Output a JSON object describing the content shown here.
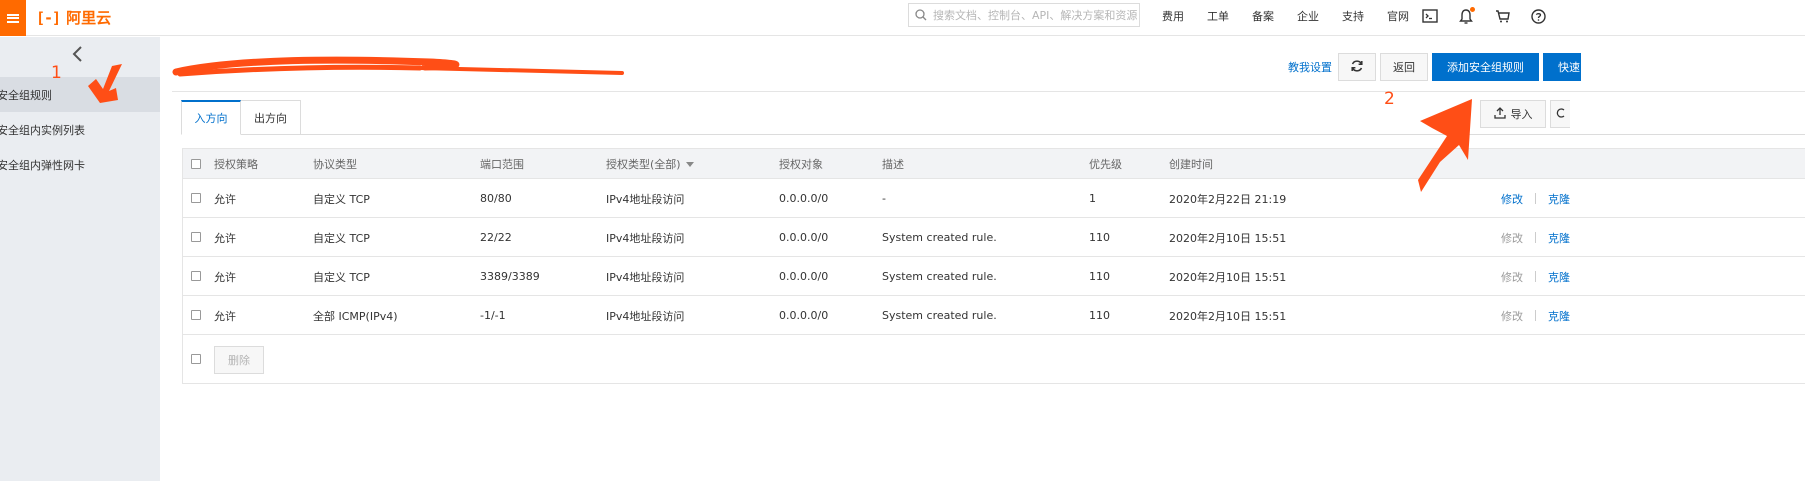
{
  "topbar": {
    "logo_mark": "[-]",
    "brand": "阿里云",
    "search_placeholder": "搜索文档、控制台、API、解决方案和资源",
    "links": [
      "费用",
      "工单",
      "备案",
      "企业",
      "支持",
      "官网"
    ],
    "icons": [
      "terminal-icon",
      "bell-icon",
      "cart-icon",
      "help-icon"
    ],
    "accent": "#ff6a00"
  },
  "sidebar": {
    "items": [
      {
        "label": "安全组规则",
        "active": true
      },
      {
        "label": "安全组内实例列表",
        "active": false
      },
      {
        "label": "安全组内弹性网卡",
        "active": false
      }
    ]
  },
  "header": {
    "help_link": "教我设置",
    "back_label": "返回",
    "add_rule_label": "添加安全组规则",
    "quick_label": "快速"
  },
  "tabs": [
    {
      "label": "入方向",
      "active": true
    },
    {
      "label": "出方向",
      "active": false
    }
  ],
  "toolbar": {
    "import_label": "导入"
  },
  "table": {
    "headers": {
      "policy": "授权策略",
      "protocol": "协议类型",
      "port": "端口范围",
      "auth_type": "授权类型(全部)",
      "target": "授权对象",
      "desc": "描述",
      "priority": "优先级",
      "created": "创建时间"
    },
    "rows": [
      {
        "policy": "允许",
        "protocol": "自定义 TCP",
        "port": "80/80",
        "auth_type": "IPv4地址段访问",
        "target": "0.0.0.0/0",
        "desc": "-",
        "priority": "1",
        "created": "2020年2月22日 21:19",
        "edit": "修改",
        "edit_enabled": true,
        "clone": "克隆"
      },
      {
        "policy": "允许",
        "protocol": "自定义 TCP",
        "port": "22/22",
        "auth_type": "IPv4地址段访问",
        "target": "0.0.0.0/0",
        "desc": "System created rule.",
        "priority": "110",
        "created": "2020年2月10日 15:51",
        "edit": "修改",
        "edit_enabled": false,
        "clone": "克隆"
      },
      {
        "policy": "允许",
        "protocol": "自定义 TCP",
        "port": "3389/3389",
        "auth_type": "IPv4地址段访问",
        "target": "0.0.0.0/0",
        "desc": "System created rule.",
        "priority": "110",
        "created": "2020年2月10日 15:51",
        "edit": "修改",
        "edit_enabled": false,
        "clone": "克隆"
      },
      {
        "policy": "允许",
        "protocol": "全部 ICMP(IPv4)",
        "port": "-1/-1",
        "auth_type": "IPv4地址段访问",
        "target": "0.0.0.0/0",
        "desc": "System created rule.",
        "priority": "110",
        "created": "2020年2月10日 15:51",
        "edit": "修改",
        "edit_enabled": false,
        "clone": "克隆"
      }
    ],
    "delete_label": "删除"
  },
  "annotations": {
    "step1": "1",
    "step2": "2",
    "color": "#ff4e16"
  }
}
